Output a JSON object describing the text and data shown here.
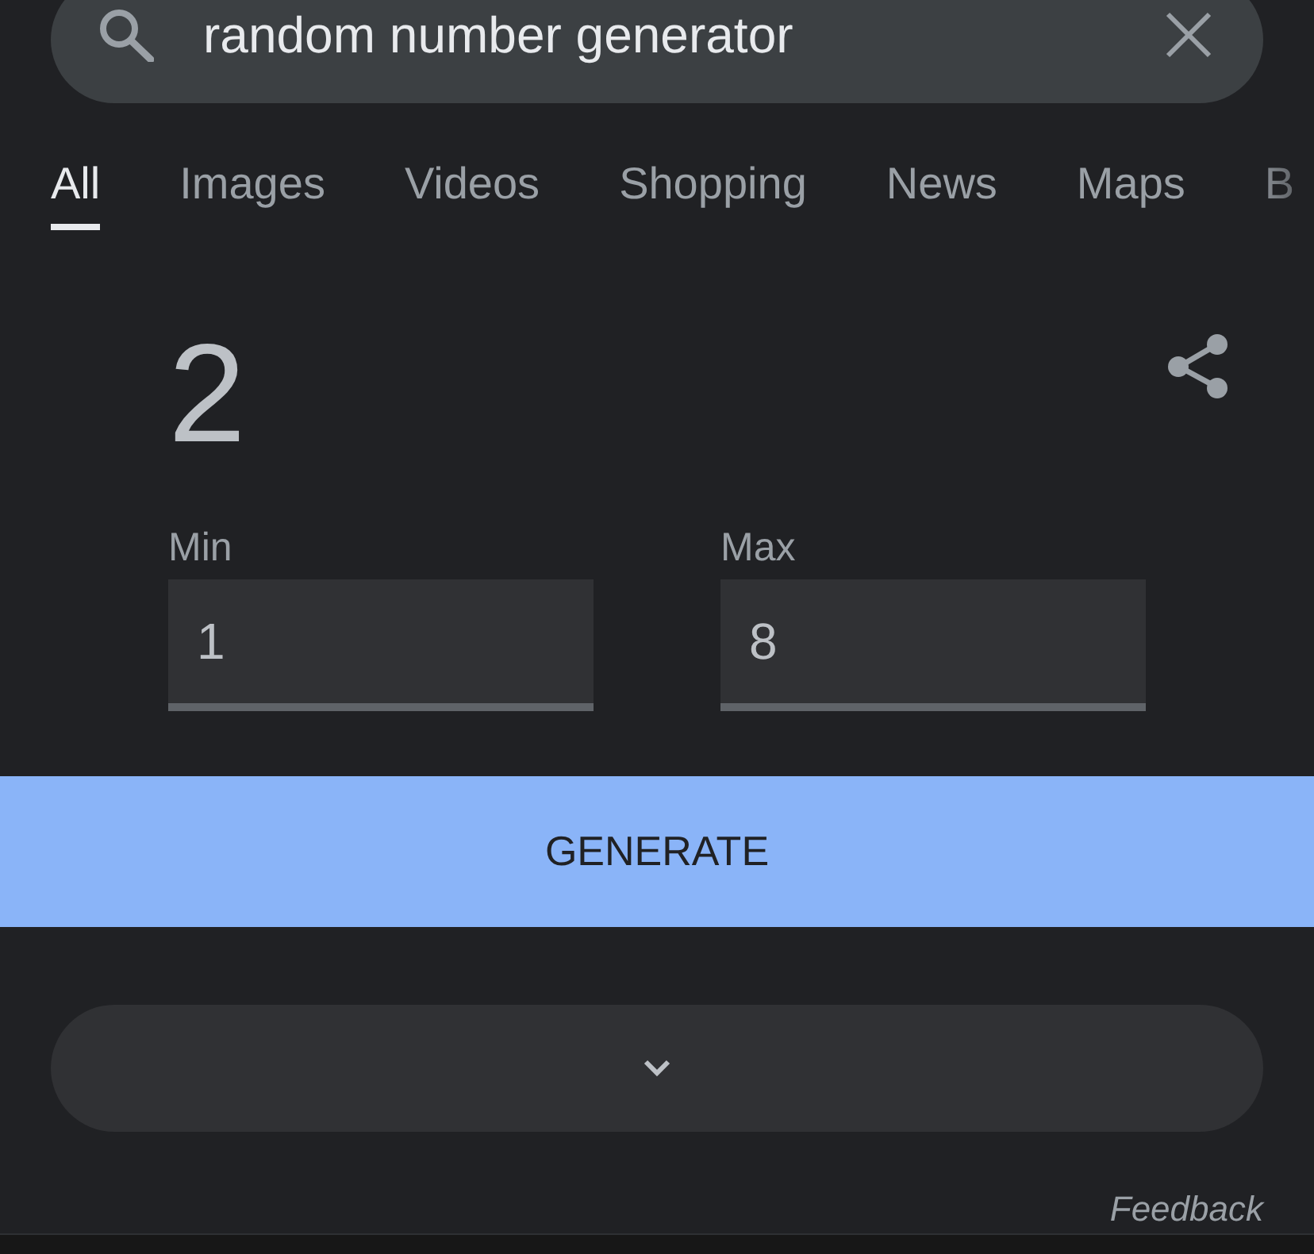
{
  "search": {
    "query": "random number generator"
  },
  "tabs": [
    {
      "label": "All",
      "selected": true
    },
    {
      "label": "Images",
      "selected": false
    },
    {
      "label": "Videos",
      "selected": false
    },
    {
      "label": "Shopping",
      "selected": false
    },
    {
      "label": "News",
      "selected": false
    },
    {
      "label": "Maps",
      "selected": false
    },
    {
      "label": "B",
      "selected": false
    }
  ],
  "result": {
    "value": "2"
  },
  "fields": [
    {
      "label": "Min",
      "value": "1"
    },
    {
      "label": "Max",
      "value": "8"
    }
  ],
  "generate_button": {
    "label": "GENERATE"
  },
  "feedback": {
    "label": "Feedback"
  }
}
